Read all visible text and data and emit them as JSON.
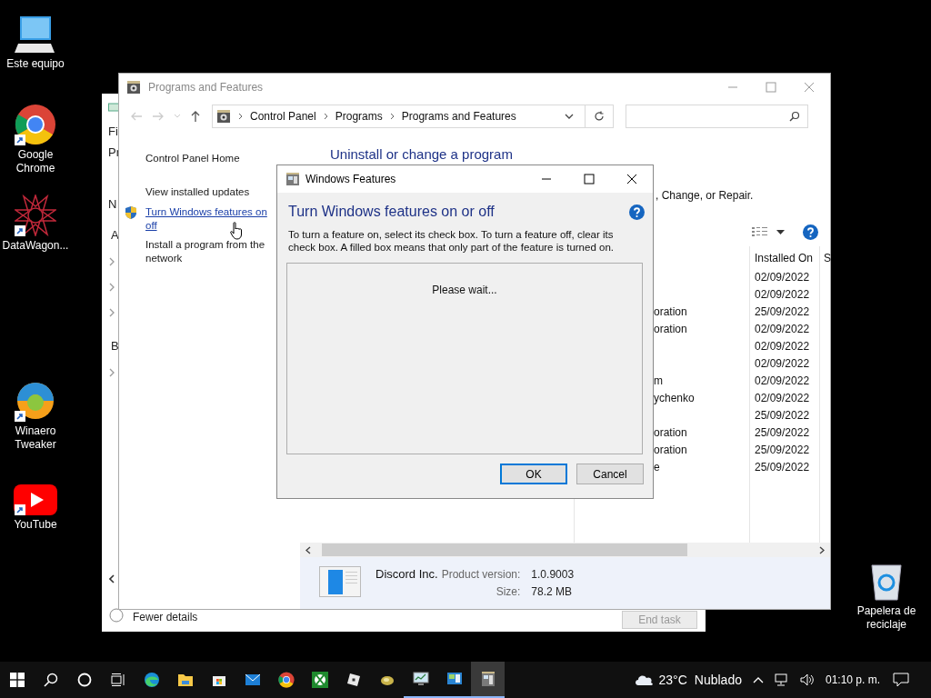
{
  "desktop_icons": [
    {
      "kind": "pc",
      "label": "Este equipo",
      "shortcut": false
    },
    {
      "kind": "chrome",
      "label": "Google Chrome",
      "shortcut": true
    },
    {
      "kind": "star",
      "label": "DataWagon...",
      "shortcut": true
    },
    {
      "kind": "swirl",
      "label": "Winaero Tweaker",
      "shortcut": true
    },
    {
      "kind": "play",
      "label": "YouTube",
      "shortcut": true
    },
    {
      "kind": "bin",
      "label": "Papelera de reciclaje",
      "shortcut": false
    }
  ],
  "back_window": {
    "fragments": [
      "Fi",
      "Pr",
      "N",
      "A",
      "B"
    ],
    "fewer_details": "Fewer details",
    "end_task": {
      "label": "End task",
      "disabled": true
    }
  },
  "programs_window": {
    "title": "Programs and Features",
    "active": false,
    "breadcrumb": [
      "Control Panel",
      "Programs",
      "Programs and Features"
    ],
    "tasks": [
      {
        "kind": "plain",
        "lines": [
          "Control Panel Home"
        ]
      },
      {
        "kind": "plain",
        "lines": [
          "View installed updates"
        ]
      },
      {
        "kind": "shield-link",
        "lines": [
          "Turn Windows features on",
          "off"
        ]
      },
      {
        "kind": "plain",
        "lines": [
          "Install a program from the",
          "network"
        ]
      }
    ],
    "heading": "Uninstall or change a program",
    "subtitle": ", Change, or Repair.",
    "columns": [
      "Installed On",
      "S"
    ],
    "rows": [
      {
        "installed_on": "02/09/2022"
      },
      {
        "installed_on": "02/09/2022"
      },
      {
        "publisher": "oration",
        "installed_on": "25/09/2022"
      },
      {
        "publisher": "oration",
        "installed_on": "02/09/2022"
      },
      {
        "installed_on": "02/09/2022"
      },
      {
        "installed_on": "02/09/2022"
      },
      {
        "publisher": "m",
        "installed_on": "02/09/2022"
      },
      {
        "publisher": "ychenko",
        "installed_on": "02/09/2022"
      },
      {
        "installed_on": "25/09/2022"
      },
      {
        "publisher": "oration",
        "installed_on": "25/09/2022"
      },
      {
        "publisher": "oration",
        "installed_on": "25/09/2022"
      },
      {
        "publisher": "e",
        "installed_on": "25/09/2022"
      }
    ],
    "details": {
      "publisher": "Discord Inc.",
      "fields": [
        {
          "label": "Product version:",
          "value": "1.0.9003"
        },
        {
          "label": "Size:",
          "value": "78.2 MB"
        }
      ]
    }
  },
  "dialog": {
    "title": "Windows Features",
    "heading": "Turn Windows features on or off",
    "description": "To turn a feature on, select its check box. To turn a feature off, clear its check box. A filled box means that only part of the feature is turned on.",
    "status": "Please wait...",
    "buttons": [
      {
        "label": "OK",
        "default": true
      },
      {
        "label": "Cancel",
        "default": false
      }
    ]
  },
  "taskbar": {
    "apps": [
      {
        "kind": "edge",
        "running": false,
        "selected": false
      },
      {
        "kind": "folder",
        "running": false,
        "selected": false
      },
      {
        "kind": "store",
        "running": false,
        "selected": false
      },
      {
        "kind": "mail",
        "running": false,
        "selected": false
      },
      {
        "kind": "chrome",
        "running": false,
        "selected": false
      },
      {
        "kind": "xbox",
        "running": false,
        "selected": false
      },
      {
        "kind": "cube",
        "running": false,
        "selected": false
      },
      {
        "kind": "ball",
        "running": false,
        "selected": false
      },
      {
        "kind": "monitor",
        "running": true,
        "selected": false
      },
      {
        "kind": "panel",
        "running": true,
        "selected": false
      },
      {
        "kind": "features",
        "running": true,
        "selected": true
      }
    ],
    "weather": {
      "temperature": "23°C",
      "condition": "Nublado"
    },
    "clock": "01:10 p. m."
  }
}
